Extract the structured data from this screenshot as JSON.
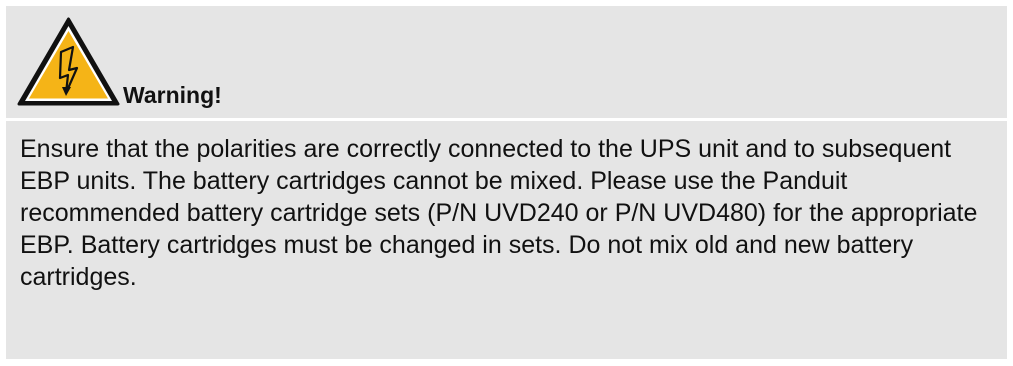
{
  "notice": {
    "heading": "Warning!",
    "icon": "high-voltage-warning-icon",
    "body": "Ensure that the polarities are correctly connected to the UPS unit and to subsequent EBP units. The battery cartridges cannot be mixed. Please use the Panduit recommended battery cartridge sets (P/N UVD240 or P/N UVD480) for the appropriate EBP. Battery cartridges must be changed in sets. Do not mix old and new battery cartridges.",
    "colors": {
      "panel_background": "#e5e5e5",
      "icon_fill": "#f5b417",
      "icon_outline": "#111111",
      "text": "#111111"
    }
  }
}
